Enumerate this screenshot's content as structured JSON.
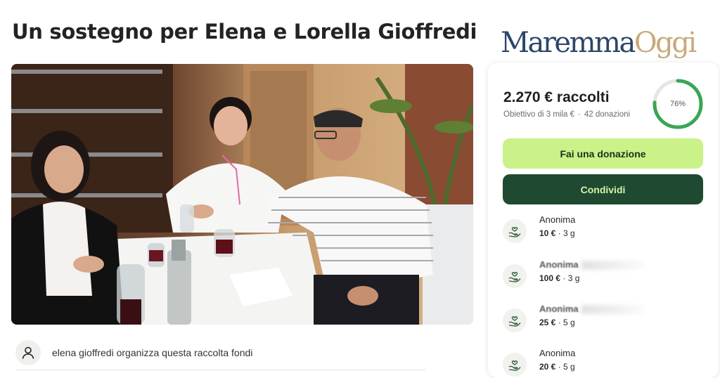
{
  "page": {
    "title": "Un sostegno per Elena e Lorella Gioffredi"
  },
  "brand": {
    "logo_part1": "Maremma",
    "logo_part2": "Oggi"
  },
  "organizer": {
    "text": "elena gioffredi organizza questa raccolta fondi"
  },
  "campaign": {
    "raised": "2.270 € raccolti",
    "goal": "Obiettivo di 3 mila €",
    "separator": "·",
    "donations_count": "42 donazioni",
    "progress_percent": 76,
    "progress_label": "76%",
    "progress_color": "#3aa655"
  },
  "actions": {
    "donate_label": "Fai una donazione",
    "share_label": "Condividi"
  },
  "donations": [
    {
      "name": "Anonima",
      "amount": "10 €",
      "time": "3 g",
      "blurred": false
    },
    {
      "name": "Anonima",
      "amount": "100 €",
      "time": "3 g",
      "blurred": true
    },
    {
      "name": "Anonima",
      "amount": "25 €",
      "time": "5 g",
      "blurred": true
    },
    {
      "name": "Anonima",
      "amount": "20 €",
      "time": "5 g",
      "blurred": false
    }
  ],
  "colors": {
    "donate_bg": "#caf288",
    "share_bg": "#1f4a31",
    "share_text": "#d6f2a8"
  },
  "icons": {
    "organizer": "user-icon",
    "donation": "heart-hand-icon"
  }
}
